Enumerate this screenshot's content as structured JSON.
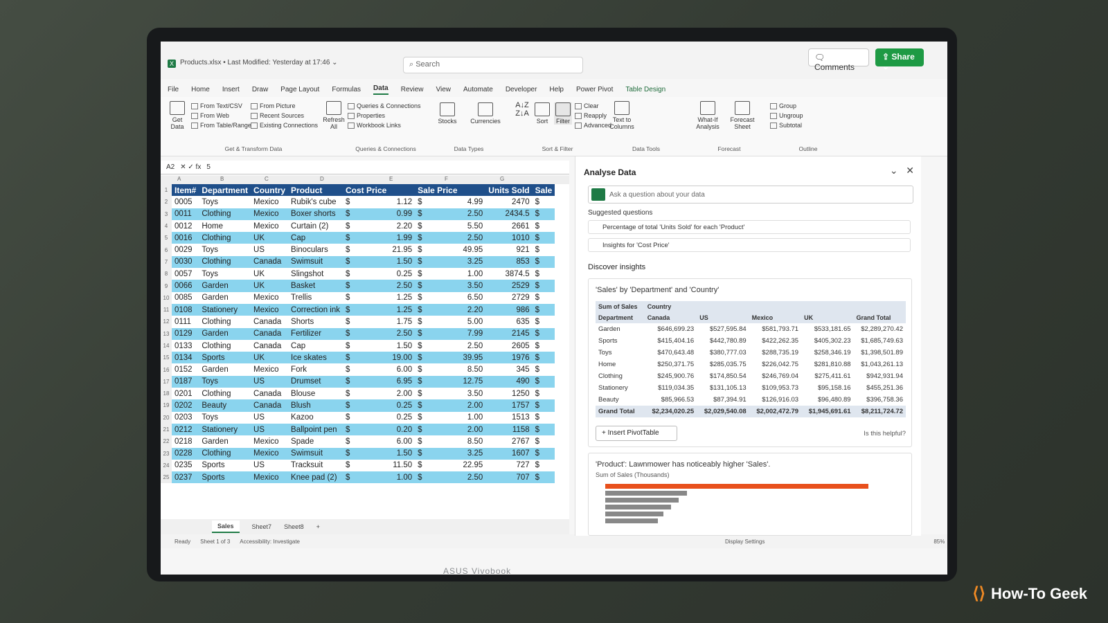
{
  "window": {
    "file_title": "Products.xlsx • Last Modified: Yesterday at 17:46 ⌄",
    "search_placeholder": "Search",
    "comments_label": "Comments",
    "share_label": "Share"
  },
  "menu": [
    "File",
    "Home",
    "Insert",
    "Draw",
    "Page Layout",
    "Formulas",
    "Data",
    "Review",
    "View",
    "Automate",
    "Developer",
    "Help",
    "Power Pivot",
    "Table Design"
  ],
  "menu_active": "Data",
  "ribbon": {
    "get_data": "Get Data",
    "get_transform": [
      "From Text/CSV",
      "From Web",
      "From Table/Range"
    ],
    "get_transform2": [
      "From Picture",
      "Recent Sources",
      "Existing Connections"
    ],
    "get_transform_label": "Get & Transform Data",
    "refresh": "Refresh All",
    "queries": [
      "Queries & Connections",
      "Properties",
      "Workbook Links"
    ],
    "queries_label": "Queries & Connections",
    "stocks": "Stocks",
    "currencies": "Currencies",
    "data_types_label": "Data Types",
    "sort": "Sort",
    "filter": "Filter",
    "filter_items": [
      "Clear",
      "Reapply",
      "Advanced"
    ],
    "sort_filter_label": "Sort & Filter",
    "text_to_columns": "Text to Columns",
    "data_tools_label": "Data Tools",
    "whatif": "What-If Analysis",
    "forecast_sheet": "Forecast Sheet",
    "forecast_label": "Forecast",
    "outline_items": [
      "Group",
      "Ungroup",
      "Subtotal"
    ],
    "outline_label": "Outline"
  },
  "formula_bar": {
    "cell_ref": "A2",
    "value": "5"
  },
  "sheet": {
    "col_letters": [
      "A",
      "B",
      "C",
      "D",
      "E",
      "F",
      "G"
    ],
    "headers": [
      "Item#",
      "Department",
      "Country",
      "Product",
      "Cost Price",
      "",
      "Sale Price",
      "",
      "Units Sold",
      "Sale"
    ],
    "rows": [
      [
        "0005",
        "Toys",
        "Mexico",
        "Rubik's cube",
        "$",
        "1.12",
        "$",
        "4.99",
        "2470",
        "$"
      ],
      [
        "0011",
        "Clothing",
        "Mexico",
        "Boxer shorts",
        "$",
        "0.99",
        "$",
        "2.50",
        "2434.5",
        "$"
      ],
      [
        "0012",
        "Home",
        "Mexico",
        "Curtain (2)",
        "$",
        "2.20",
        "$",
        "5.50",
        "2661",
        "$"
      ],
      [
        "0016",
        "Clothing",
        "UK",
        "Cap",
        "$",
        "1.99",
        "$",
        "2.50",
        "1010",
        "$"
      ],
      [
        "0029",
        "Toys",
        "US",
        "Binoculars",
        "$",
        "21.95",
        "$",
        "49.95",
        "921",
        "$"
      ],
      [
        "0030",
        "Clothing",
        "Canada",
        "Swimsuit",
        "$",
        "1.50",
        "$",
        "3.25",
        "853",
        "$"
      ],
      [
        "0057",
        "Toys",
        "UK",
        "Slingshot",
        "$",
        "0.25",
        "$",
        "1.00",
        "3874.5",
        "$"
      ],
      [
        "0066",
        "Garden",
        "UK",
        "Basket",
        "$",
        "2.50",
        "$",
        "3.50",
        "2529",
        "$"
      ],
      [
        "0085",
        "Garden",
        "Mexico",
        "Trellis",
        "$",
        "1.25",
        "$",
        "6.50",
        "2729",
        "$"
      ],
      [
        "0108",
        "Stationery",
        "Mexico",
        "Correction ink",
        "$",
        "1.25",
        "$",
        "2.20",
        "986",
        "$"
      ],
      [
        "0111",
        "Clothing",
        "Canada",
        "Shorts",
        "$",
        "1.75",
        "$",
        "5.00",
        "635",
        "$"
      ],
      [
        "0129",
        "Garden",
        "Canada",
        "Fertilizer",
        "$",
        "2.50",
        "$",
        "7.99",
        "2145",
        "$"
      ],
      [
        "0133",
        "Clothing",
        "Canada",
        "Cap",
        "$",
        "1.50",
        "$",
        "2.50",
        "2605",
        "$"
      ],
      [
        "0134",
        "Sports",
        "UK",
        "Ice skates",
        "$",
        "19.00",
        "$",
        "39.95",
        "1976",
        "$"
      ],
      [
        "0152",
        "Garden",
        "Mexico",
        "Fork",
        "$",
        "6.00",
        "$",
        "8.50",
        "345",
        "$"
      ],
      [
        "0187",
        "Toys",
        "US",
        "Drumset",
        "$",
        "6.95",
        "$",
        "12.75",
        "490",
        "$"
      ],
      [
        "0201",
        "Clothing",
        "Canada",
        "Blouse",
        "$",
        "2.00",
        "$",
        "3.50",
        "1250",
        "$"
      ],
      [
        "0202",
        "Beauty",
        "Canada",
        "Blush",
        "$",
        "0.25",
        "$",
        "2.00",
        "1757",
        "$"
      ],
      [
        "0203",
        "Toys",
        "US",
        "Kazoo",
        "$",
        "0.25",
        "$",
        "1.00",
        "1513",
        "$"
      ],
      [
        "0212",
        "Stationery",
        "US",
        "Ballpoint pen",
        "$",
        "0.20",
        "$",
        "2.00",
        "1158",
        "$"
      ],
      [
        "0218",
        "Garden",
        "Mexico",
        "Spade",
        "$",
        "6.00",
        "$",
        "8.50",
        "2767",
        "$"
      ],
      [
        "0228",
        "Clothing",
        "Mexico",
        "Swimsuit",
        "$",
        "1.50",
        "$",
        "3.25",
        "1607",
        "$"
      ],
      [
        "0235",
        "Sports",
        "US",
        "Tracksuit",
        "$",
        "11.50",
        "$",
        "22.95",
        "727",
        "$"
      ],
      [
        "0237",
        "Sports",
        "Mexico",
        "Knee pad (2)",
        "$",
        "1.00",
        "$",
        "2.50",
        "707",
        "$"
      ]
    ],
    "tabs": [
      "Sales",
      "Sheet7",
      "Sheet8"
    ],
    "active_tab": "Sales"
  },
  "status": {
    "ready": "Ready",
    "sheet_of": "Sheet 1 of 3",
    "accessibility": "Accessibility: Investigate",
    "display_settings": "Display Settings",
    "zoom": "85%"
  },
  "pane": {
    "title": "Analyse Data",
    "ask_placeholder": "Ask a question about your data",
    "suggested_title": "Suggested questions",
    "suggestions": [
      "Percentage of total 'Units Sold' for each 'Product'",
      "Insights for 'Cost Price'"
    ],
    "discover": "Discover insights",
    "card_title": "'Sales' by 'Department' and 'Country'",
    "pivot": {
      "corner": "Sum of Sales",
      "country_label": "Country",
      "dept_label": "Department",
      "columns": [
        "Canada",
        "US",
        "Mexico",
        "UK",
        "Grand Total"
      ],
      "rows": [
        [
          "Garden",
          "$646,699.23",
          "$527,595.84",
          "$581,793.71",
          "$533,181.65",
          "$2,289,270.42"
        ],
        [
          "Sports",
          "$415,404.16",
          "$442,780.89",
          "$422,262.35",
          "$405,302.23",
          "$1,685,749.63"
        ],
        [
          "Toys",
          "$470,643.48",
          "$380,777.03",
          "$288,735.19",
          "$258,346.19",
          "$1,398,501.89"
        ],
        [
          "Home",
          "$250,371.75",
          "$285,035.75",
          "$226,042.75",
          "$281,810.88",
          "$1,043,261.13"
        ],
        [
          "Clothing",
          "$245,900.76",
          "$174,850.54",
          "$246,769.04",
          "$275,411.61",
          "$942,931.94"
        ],
        [
          "Stationery",
          "$119,034.35",
          "$131,105.13",
          "$109,953.73",
          "$95,158.16",
          "$455,251.36"
        ],
        [
          "Beauty",
          "$85,966.53",
          "$87,394.91",
          "$126,916.03",
          "$96,480.89",
          "$396,758.36"
        ]
      ],
      "grand_total": [
        "Grand Total",
        "$2,234,020.25",
        "$2,029,540.08",
        "$2,002,472.79",
        "$1,945,691.61",
        "$8,211,724.72"
      ]
    },
    "insert_pivot": "Insert PivotTable",
    "helpful": "Is this helpful?",
    "card2_title": "'Product': Lawnmower has noticeably higher 'Sales'.",
    "card2_sub": "Sum of Sales (Thousands)",
    "bars": [
      1.0,
      0.31,
      0.28,
      0.25,
      0.22,
      0.2
    ],
    "bar_colors": {
      "highlight": "#e8501c",
      "normal": "#888888"
    }
  },
  "brand": "ASUS Vivobook",
  "watermark": "How-To Geek",
  "colors": {
    "header_blue": "#1f4f8a",
    "band_cyan": "#8ad4ee",
    "excel_green": "#1e7a45"
  }
}
